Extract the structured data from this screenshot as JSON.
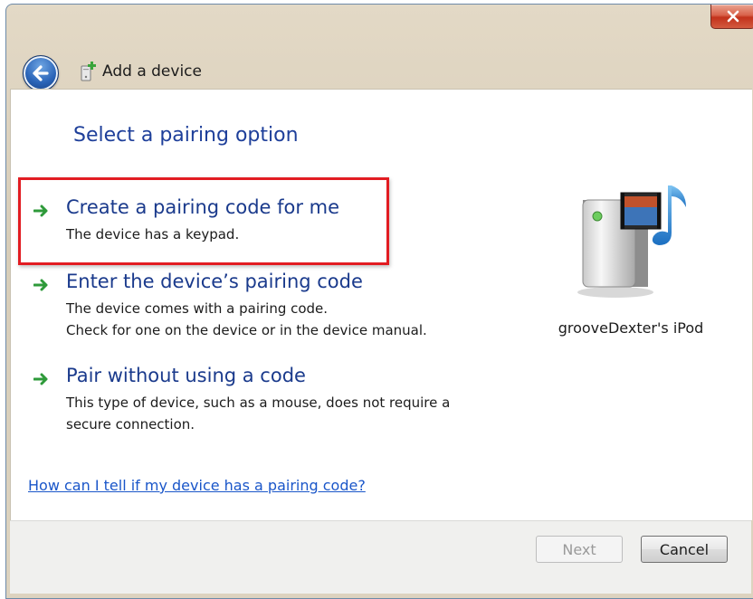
{
  "window": {
    "title": "Add a device",
    "close_icon": "close-x-icon",
    "back_icon": "back-arrow-icon",
    "title_icon": "add-device-icon"
  },
  "content": {
    "heading": "Select a pairing option",
    "options": [
      {
        "title": "Create a pairing code for me",
        "description_lines": [
          "The device has a keypad."
        ],
        "highlighted": true
      },
      {
        "title": "Enter the device’s pairing code",
        "description_lines": [
          "The device comes with a pairing code.",
          "Check for one on the device or in the device manual."
        ],
        "highlighted": false
      },
      {
        "title": "Pair without using a code",
        "description_lines": [
          "This type of device, such as a mouse, does not require a",
          "secure connection."
        ],
        "highlighted": false
      }
    ],
    "help_link": "How can I tell if my device has a pairing code?",
    "device": {
      "name": "grooveDexter's iPod",
      "icon": "media-player-device-icon"
    }
  },
  "footer": {
    "next_label": "Next",
    "next_enabled": false,
    "cancel_label": "Cancel"
  },
  "colors": {
    "heading": "#1e3f9a",
    "link": "#1a56c9",
    "highlight_border": "#e21c22",
    "arrow": "#2e9a3a"
  }
}
